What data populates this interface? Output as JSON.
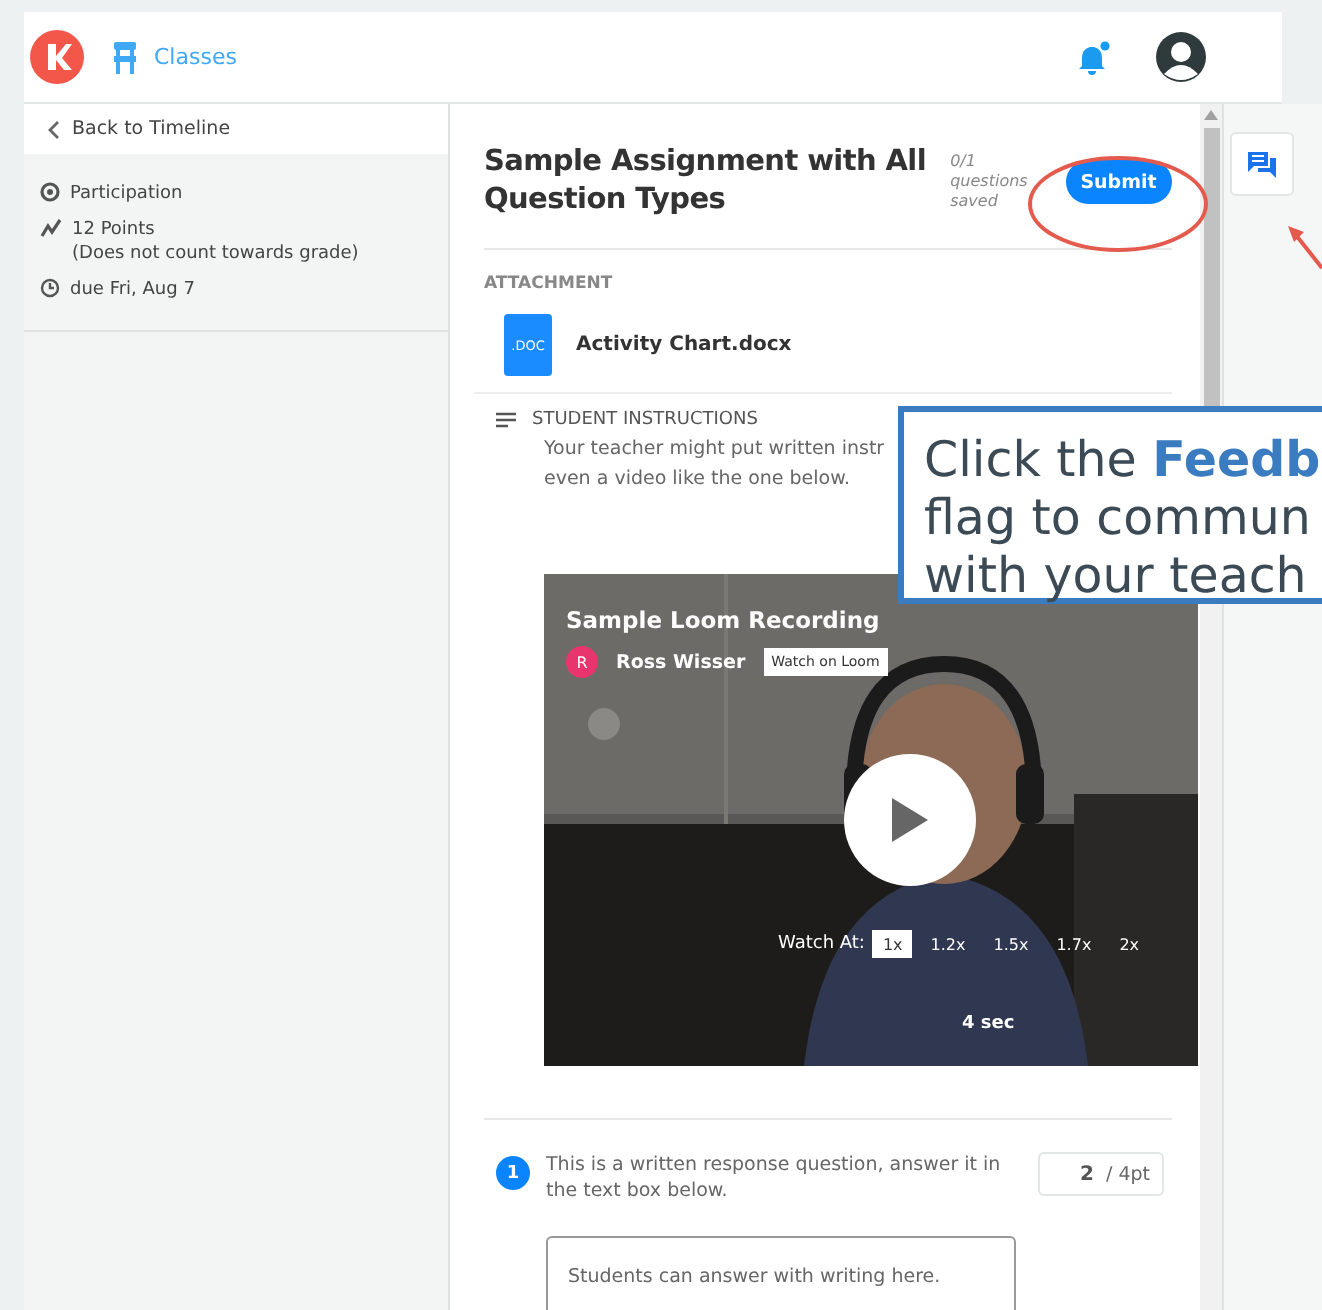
{
  "header": {
    "nav_label": "Classes",
    "has_notification": true
  },
  "sidebar": {
    "back_link": "Back to Timeline",
    "meta": [
      {
        "kind": "participation",
        "text": "Participation"
      },
      {
        "kind": "points",
        "text": "12 Points",
        "note": "(Does not count towards grade)"
      },
      {
        "kind": "due",
        "text": "due Fri, Aug 7"
      }
    ]
  },
  "assignment": {
    "title": "Sample Assignment with All Question Types",
    "progress_count": "0/1",
    "progress_label": "questions saved",
    "submit": "Submit"
  },
  "attachment": {
    "heading": "ATTACHMENT",
    "file_badge": ".DOC",
    "file_name": "Activity Chart.docx"
  },
  "instructions": {
    "heading": "STUDENT INSTRUCTIONS",
    "lines": [
      "Your teacher might put written instr",
      "even a video like the one below."
    ]
  },
  "video": {
    "title": "Sample Loom Recording",
    "author_initial": "R",
    "author": "Ross Wisser",
    "watch_button": "Watch on Loom",
    "speed_label": "Watch At:",
    "speeds": [
      {
        "label": "1x",
        "selected": true
      },
      {
        "label": "1.2x",
        "selected": false
      },
      {
        "label": "1.5x",
        "selected": false
      },
      {
        "label": "1.7x",
        "selected": false
      },
      {
        "label": "2x",
        "selected": false
      }
    ],
    "duration": "4 sec"
  },
  "question": {
    "number": "1",
    "text": "This is a written response question, answer it in the text box below.",
    "score": "2",
    "max": "/ 4pt",
    "placeholder": "Students can answer with writing here."
  },
  "callout": {
    "lines": [
      "Click the **Feedb**",
      "flag to commun",
      "with your teach"
    ]
  }
}
